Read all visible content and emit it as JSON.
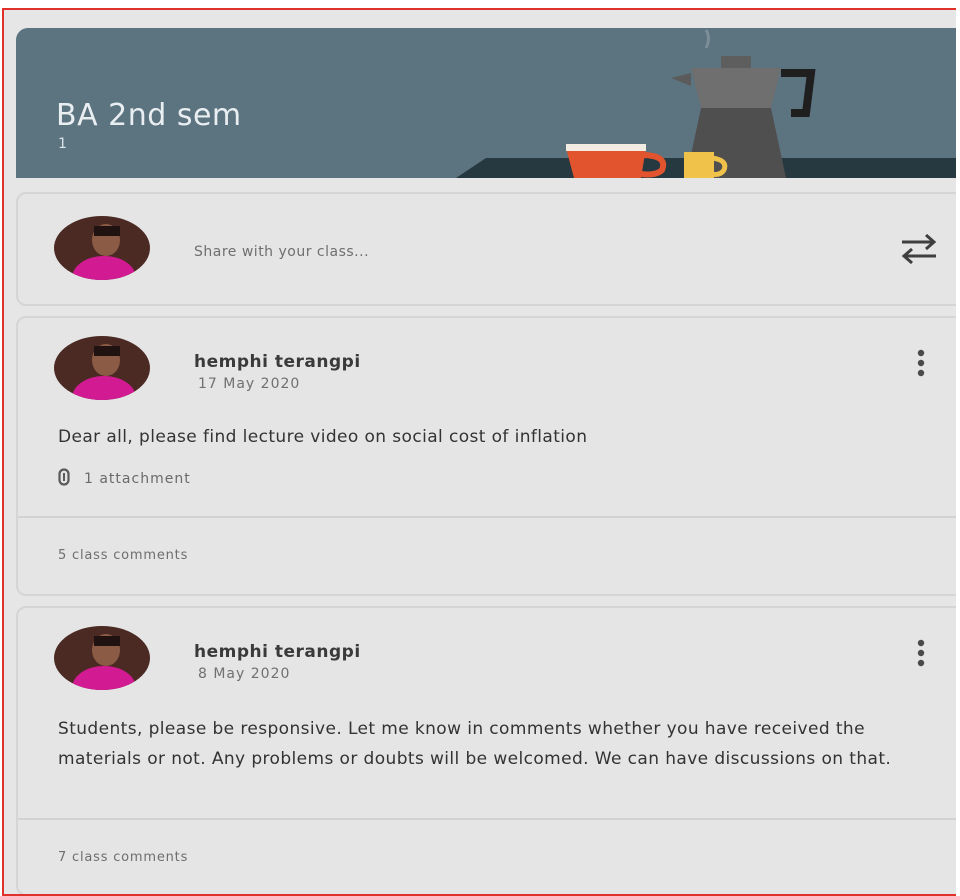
{
  "banner": {
    "title": "BA 2nd sem",
    "subtitle": "1",
    "color": "#5c7380"
  },
  "share": {
    "placeholder": "Share with your class...",
    "action_icon": "repost-icon"
  },
  "posts": [
    {
      "author": "hemphi terangpi",
      "date": "17 May 2020",
      "text": "Dear all, please find lecture video on social cost of inflation",
      "attachment": "1 attachment",
      "comments": "5 class comments"
    },
    {
      "author": "hemphi terangpi",
      "date": "8 May 2020",
      "text": "Students, please be responsive. Let me know in comments whether you have received the materials or not. Any problems or doubts will be welcomed. We can have discussions on that.",
      "comments": "7 class comments"
    }
  ],
  "colors": {
    "frame_border": "#e0312a",
    "background": "#e6e6e6",
    "card_border": "#d5d5d5"
  }
}
